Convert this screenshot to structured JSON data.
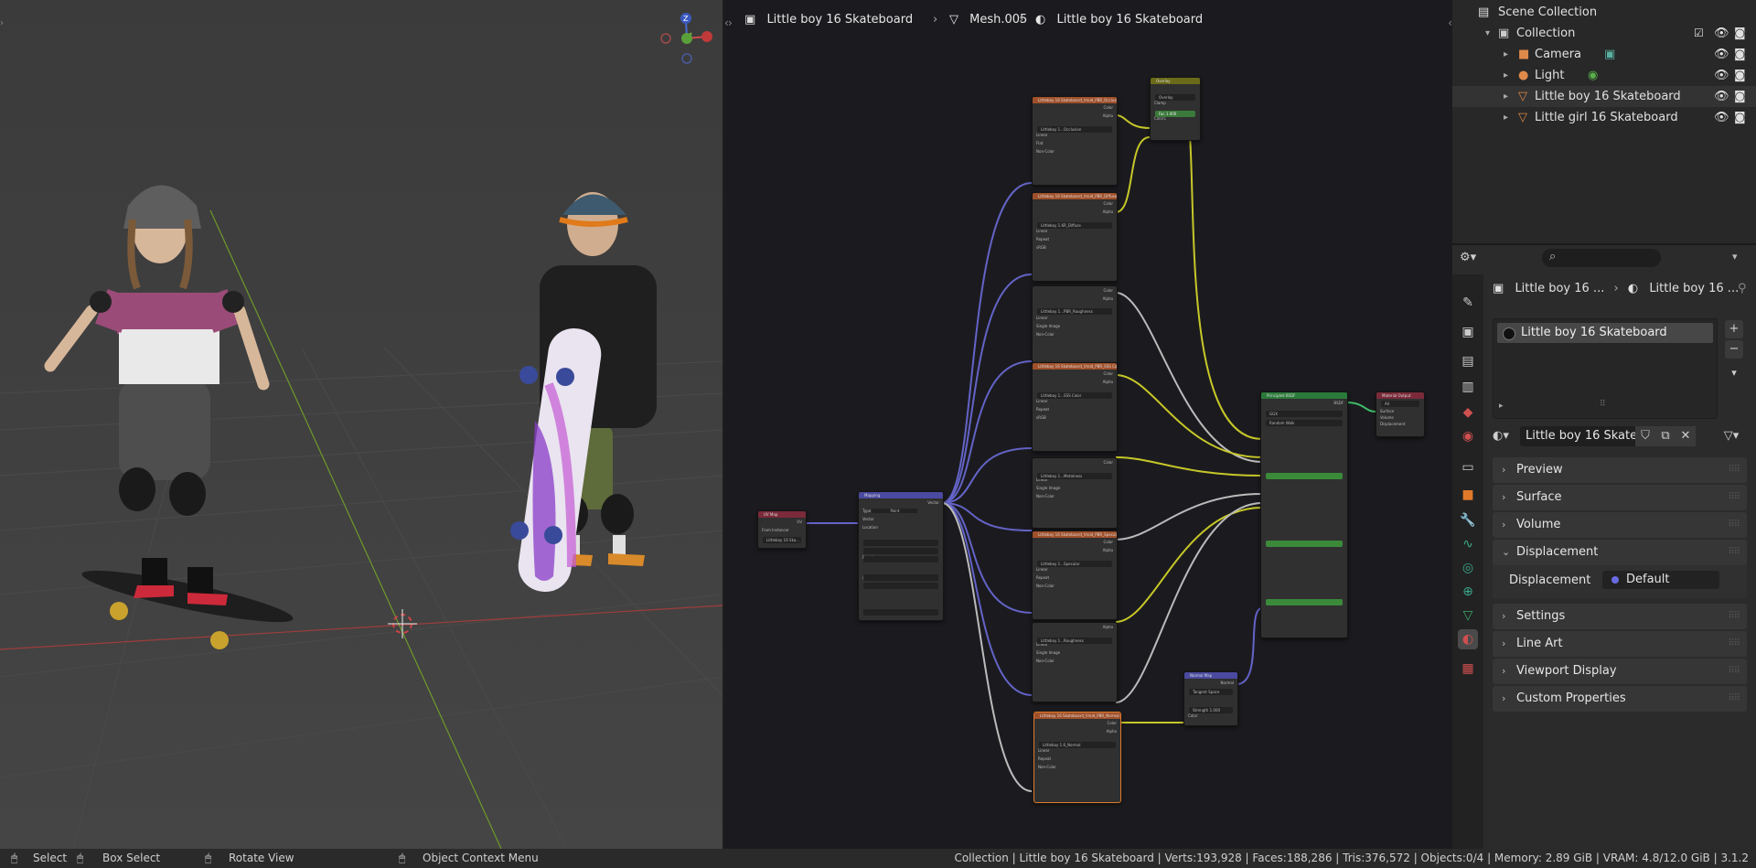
{
  "viewport": {
    "mode": "3D Viewport",
    "gizmo_axes": [
      "Z",
      "Y",
      "X"
    ]
  },
  "node_editor": {
    "breadcrumbs": [
      "Little boy 16 Skateboard",
      "Mesh.005",
      "Little boy 16 Skateboard"
    ],
    "nodes": {
      "uv_map": {
        "title": "UV Map",
        "output": "UV",
        "row1": "From Instancer",
        "row2": "Littleboy 16 Ska..."
      },
      "mapping": {
        "title": "Mapping",
        "output": "Vector",
        "type_label": "Type",
        "type_value": "Point",
        "input": "Vector",
        "location": "Location",
        "rotation": "Rotation",
        "scale": "Scale"
      },
      "tex1": {
        "title": "Littleboy 16 Skateboard_Vroid_PBR_Occlusion",
        "file": "Littleboy 1...Occlusion",
        "colorspace": "Non-Color"
      },
      "tex2": {
        "title": "Littleboy 16 Skateboard_Vroid_PBR_Diffuse",
        "file": "Littleboy 1.6R_Diffuse",
        "colorspace": "sRGB"
      },
      "tex3": {
        "title": "",
        "file": "Littleboy 1...PBR_Roughness",
        "colorspace": "Non-Color"
      },
      "tex4": {
        "title": "Littleboy 16 Skateboard_Vroid_PBR_SSS Color",
        "file": "Littleboy 1...SSS Color",
        "colorspace": "sRGB"
      },
      "tex5": {
        "title": "",
        "file": "Littleboy 1...Metalness",
        "colorspace": "Non-Color"
      },
      "tex6": {
        "title": "Littleboy 16 Skateboard_Vroid_PBR_Specular",
        "file": "Littleboy 1...Specular",
        "colorspace": "Non-Color"
      },
      "tex7": {
        "title": "",
        "file": "Littleboy 1...Roughness",
        "colorspace": "Non-Color"
      },
      "tex8": {
        "title": "Littleboy 16 Skateboard_Vroid_PBR_Normal",
        "file": "Littleboy 1.6_Normal",
        "colorspace": "Non-Color"
      },
      "overlay": {
        "title": "Overlay",
        "blend": "Overlay",
        "clamp": "Clamp",
        "fac": "Fac",
        "fac_value": "1.000",
        "c1": "Color1",
        "c2": "Color2"
      },
      "principled": {
        "title": "Principled BSDF",
        "output": "BSDF",
        "dist": "GGX",
        "sss": "Random Walk"
      },
      "output": {
        "title": "Material Output",
        "target": "All",
        "surface": "Surface",
        "volume": "Volume",
        "displacement": "Displacement"
      },
      "normal_map": {
        "title": "Normal Map",
        "output": "Normal",
        "space": "Tangent Space",
        "strength": "Strength",
        "strength_value": "1.000",
        "color": "Color"
      },
      "tex_rows": {
        "color": "Color",
        "alpha": "Alpha",
        "interp": "Linear",
        "proj": "Flat",
        "ext": "Repeat",
        "src": "Single Image",
        "cs": "Color Space",
        "vec": "Vector"
      }
    }
  },
  "outliner": {
    "root": "Scene Collection",
    "collection": "Collection",
    "items": [
      "Camera",
      "Light",
      "Little boy 16 Skateboard",
      "Little girl 16 Skateboard"
    ]
  },
  "properties": {
    "breadcrumb": [
      "Little boy 16 ...",
      "Little boy 16 ..."
    ],
    "slot": "Little boy 16 Skateboard",
    "material_name": "Little boy 16 Skate...",
    "panels": [
      "Preview",
      "Surface",
      "Volume",
      "Displacement",
      "Settings",
      "Line Art",
      "Viewport Display",
      "Custom Properties"
    ],
    "displacement_label": "Displacement",
    "displacement_value": "Default"
  },
  "status": {
    "select": "Select",
    "box_select": "Box Select",
    "rotate": "Rotate View",
    "context": "Object Context Menu",
    "stats": "Collection | Little boy 16 Skateboard | Verts:193,928 | Faces:188,286 | Tris:376,572 | Objects:0/4 | Memory: 2.89 GiB | VRAM: 4.8/12.0 GiB | 3.1.2"
  }
}
